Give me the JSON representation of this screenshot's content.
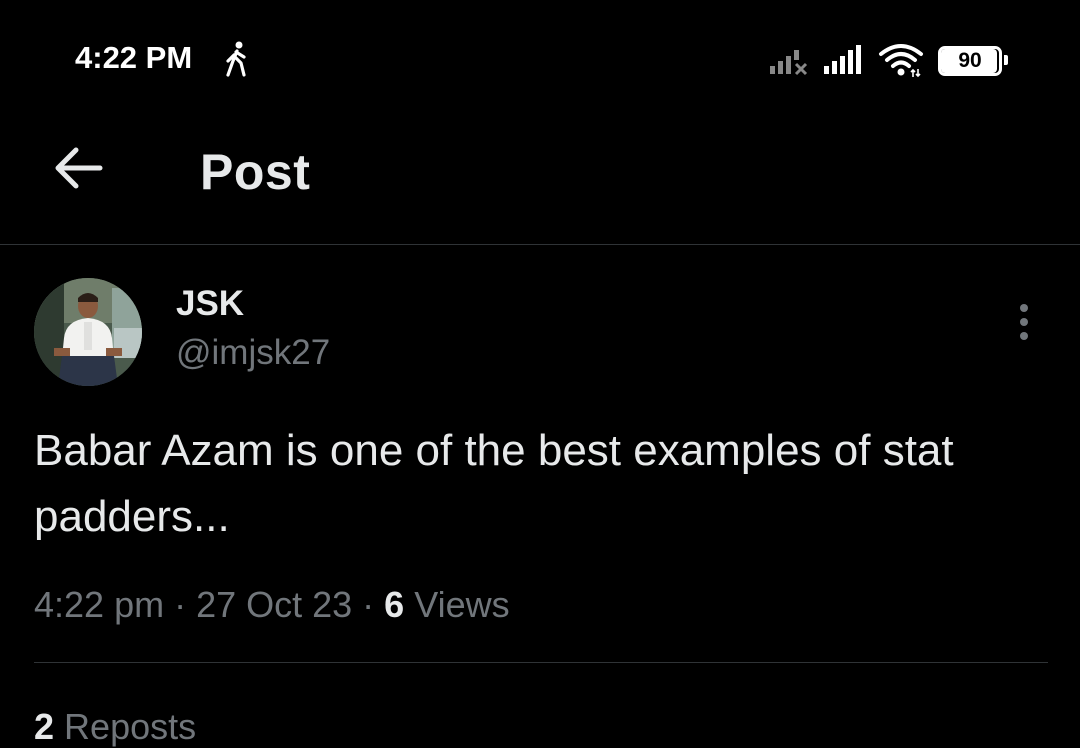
{
  "status_bar": {
    "time": "4:22 PM",
    "battery": "90",
    "icons": [
      "walking-icon",
      "signal-no-service-icon",
      "signal-icon",
      "wifi-icon",
      "battery-icon"
    ]
  },
  "header": {
    "title": "Post",
    "back_icon": "arrow-left-icon"
  },
  "post": {
    "author": {
      "display_name": "JSK",
      "handle": "@imjsk27"
    },
    "more_icon": "more-vertical-icon",
    "text": "Babar Azam is one of the best examples of stat padders...",
    "time": "4:22 pm",
    "separator": " · ",
    "date": "27 Oct 23",
    "views_count": "6",
    "views_label": "Views"
  },
  "stats": {
    "reposts_count": "2",
    "reposts_label": "Reposts"
  },
  "colors": {
    "background": "#000000",
    "text_primary": "#e7e9ea",
    "text_secondary": "#71767b",
    "divider": "#2f3336"
  }
}
